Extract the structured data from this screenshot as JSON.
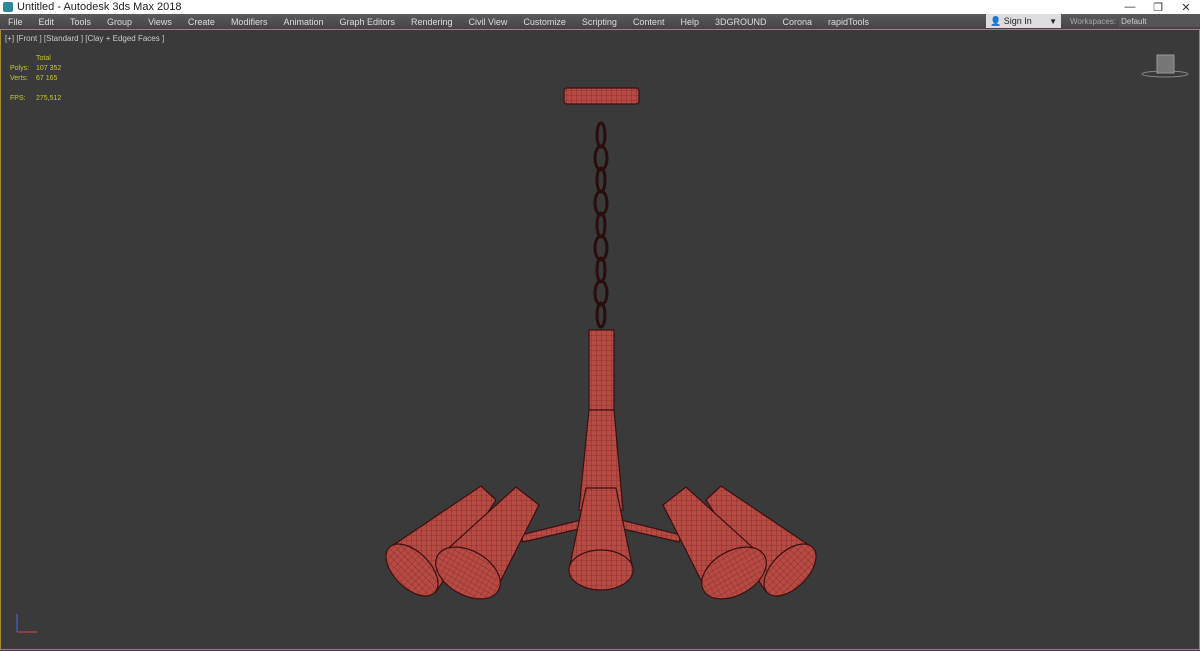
{
  "window": {
    "title": "Untitled - Autodesk 3ds Max 2018",
    "controls": [
      "—",
      "❐",
      "✕"
    ]
  },
  "menu": [
    "File",
    "Edit",
    "Tools",
    "Group",
    "Views",
    "Create",
    "Modifiers",
    "Animation",
    "Graph Editors",
    "Rendering",
    "Civil View",
    "Customize",
    "Scripting",
    "Content",
    "Help",
    "3DGROUND",
    "Corona",
    "rapidTools"
  ],
  "signin": {
    "label": "Sign In",
    "icon": "user-icon"
  },
  "workspaces": {
    "label": "Workspaces:",
    "value": "Default"
  },
  "viewport": {
    "label": "[+] [Front ] [Standard ] [Clay + Edged Faces ]",
    "stats": {
      "header": "Total",
      "polys_label": "Polys:",
      "polys": "107 352",
      "verts_label": "Verts:",
      "verts": "67 165",
      "fps_label": "FPS:",
      "fps": "275,512"
    },
    "model_color": "#b84a44",
    "border_color": "#a58c3c"
  }
}
